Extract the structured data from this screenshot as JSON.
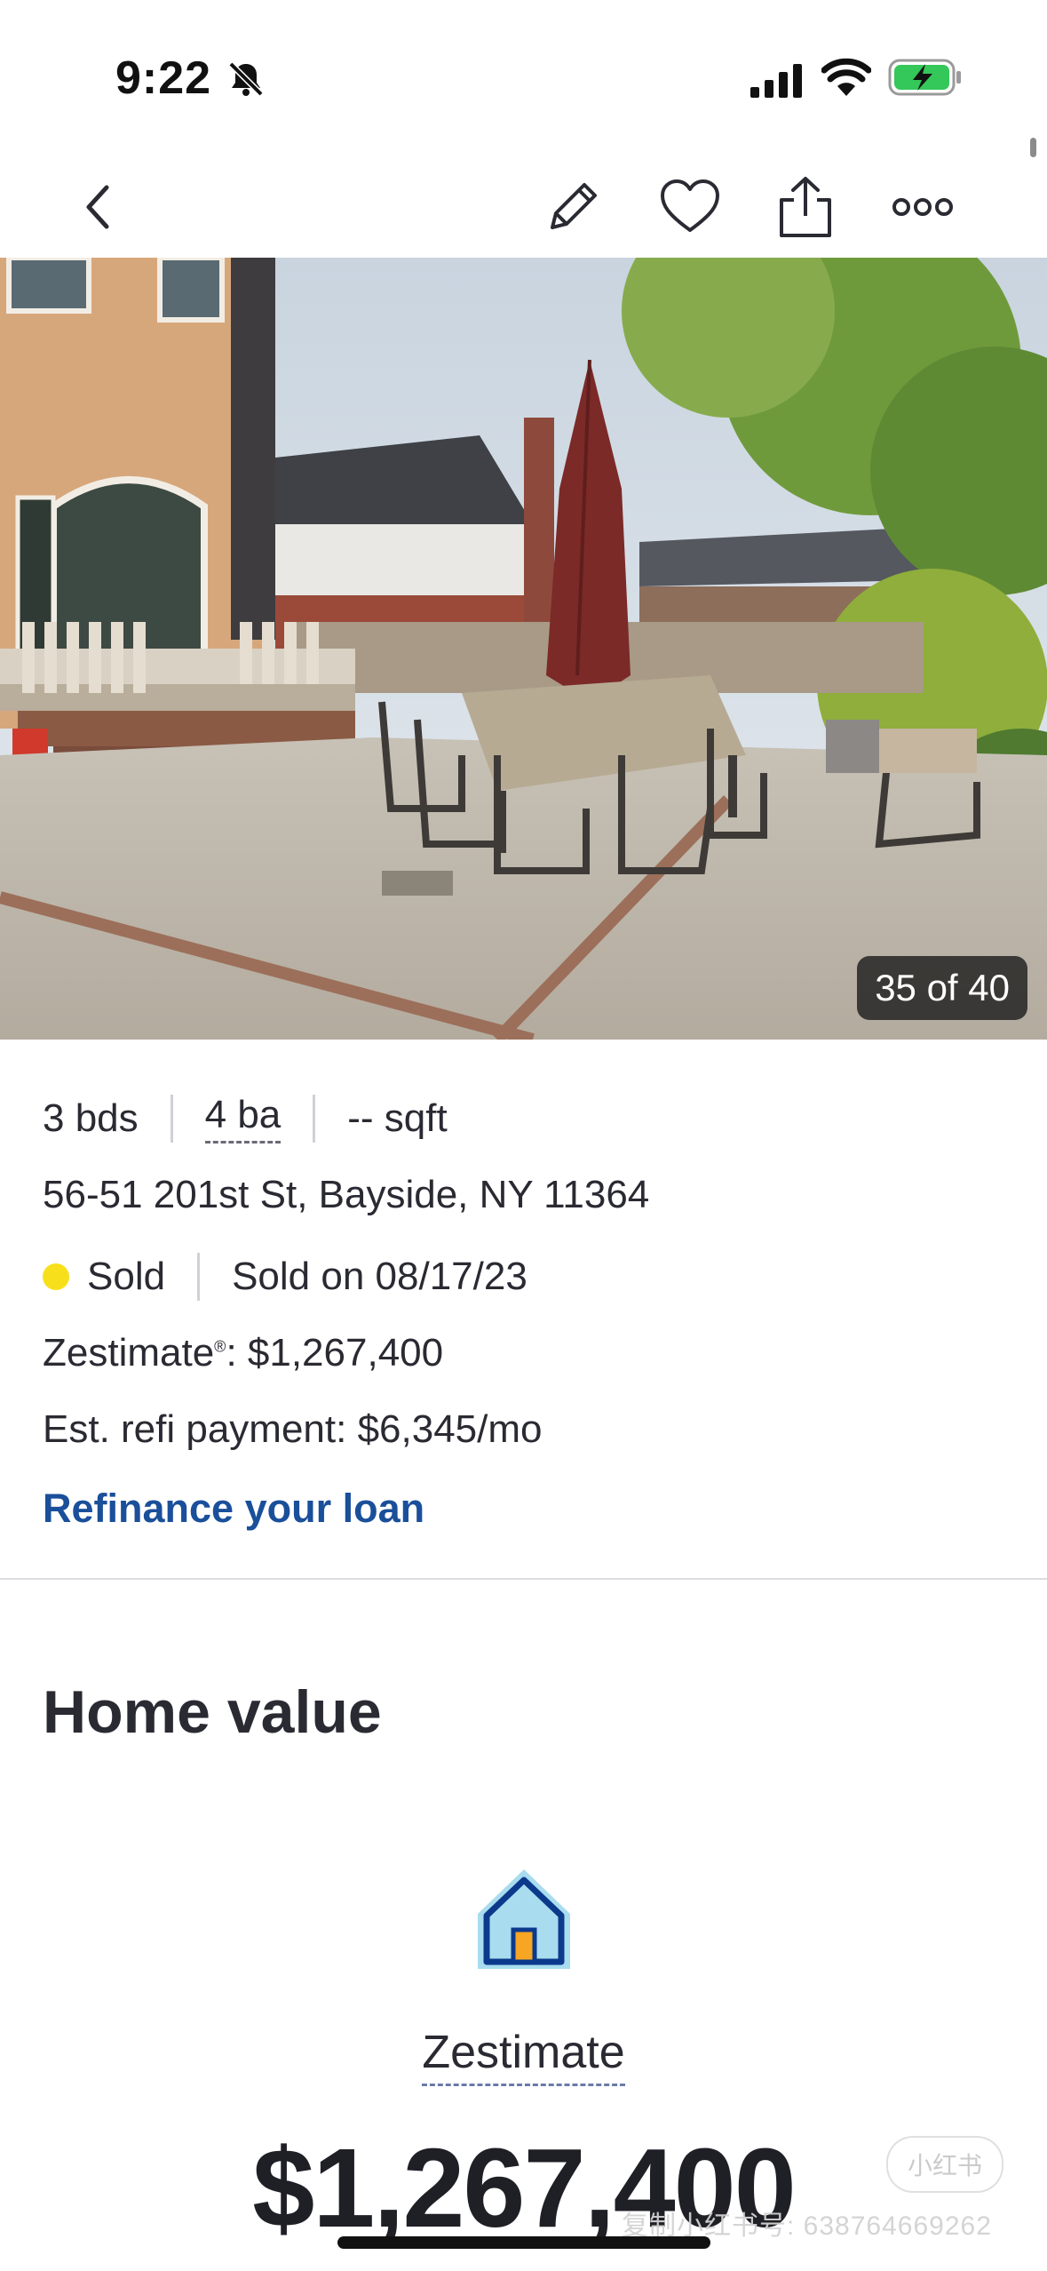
{
  "status_bar": {
    "time": "9:22"
  },
  "nav": {
    "icons": [
      "back-icon",
      "pencil-icon",
      "heart-icon",
      "share-icon",
      "more-icon"
    ]
  },
  "photo": {
    "counter": "35 of 40"
  },
  "listing": {
    "beds": "3 bds",
    "baths": "4 ba",
    "sqft": "-- sqft",
    "address": "56-51 201st St, Bayside, NY 11364",
    "status": "Sold",
    "status_color": "#f7e01b",
    "sold_date": "Sold on 08/17/23",
    "zestimate_label": "Zestimate",
    "zestimate_reg": "®",
    "zestimate_value_text": ": $1,267,400",
    "refi_payment": "Est. refi payment: $6,345/mo",
    "refi_link": "Refinance your loan",
    "link_color": "#1a4f9a"
  },
  "home_value": {
    "title": "Home value",
    "icon": "house-icon",
    "zestimate_label": "Zestimate",
    "zestimate_value": "$1,267,400"
  },
  "watermark": {
    "badge": "小红书",
    "text": "复制小红书号: 638764669262"
  }
}
